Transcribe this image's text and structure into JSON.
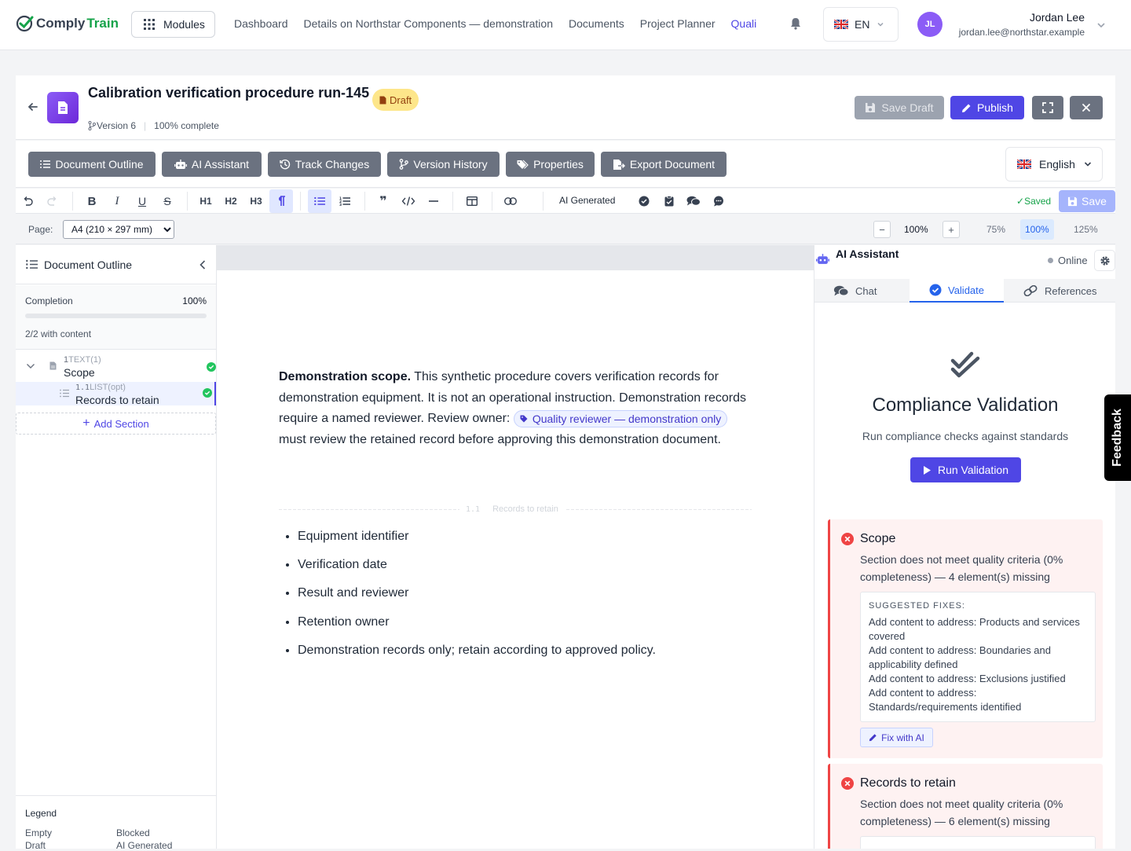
{
  "app": {
    "logo_part1": "Comply",
    "logo_part2": "Train",
    "modules_label": "Modules",
    "nav": [
      "Dashboard",
      "Details on Northstar Components — demonstration",
      "Documents",
      "Project Planner",
      "Quali"
    ],
    "lang_code": "EN"
  },
  "user": {
    "initials": "JL",
    "name": "Jordan Lee",
    "email": "jordan.lee@northstar.example"
  },
  "document": {
    "title": "Calibration verification procedure run-145",
    "status": "Draft",
    "version": "Version 6",
    "completion_text": "100% complete",
    "save_draft_label": "Save Draft",
    "publish_label": "Publish"
  },
  "views": [
    "Document Outline",
    "AI Assistant",
    "Track Changes",
    "Version History",
    "Properties",
    "Export Document"
  ],
  "language": "English",
  "format": {
    "h1": "H1",
    "h2": "H2",
    "h3": "H3",
    "ai_generated": "AI Generated",
    "saved": "Saved",
    "save": "Save"
  },
  "page": {
    "label": "Page:",
    "size": "A4 (210 × 297 mm)",
    "options": [
      "A4 (210 × 297 mm)"
    ],
    "zoom": "100%",
    "zoom_presets": [
      "75%",
      "100%",
      "125%"
    ],
    "zoom_minus": "−",
    "zoom_plus": "+"
  },
  "outline": {
    "title": "Document Outline",
    "completion_label": "Completion",
    "completion_value": "100%",
    "completion_fraction": 1.0,
    "content_count": "2/2 with content",
    "items": [
      {
        "num": "1",
        "type": "TEXT(1)",
        "name": "Scope"
      },
      {
        "num": "1.1",
        "type": "LIST(opt)",
        "name": "Records to retain"
      }
    ],
    "add_section": "Add Section",
    "legend_title": "Legend",
    "legend": [
      "Empty",
      "Blocked",
      "Draft",
      "AI Generated"
    ]
  },
  "editor": {
    "intro_bold": "Demonstration scope.",
    "intro_text": " This synthetic procedure covers verification records for demonstration equipment. It is not an operational instruction. Demonstration records require a named reviewer. Review owner: ",
    "chip": "Quality reviewer — demonstration only",
    "intro_tail": " must review the retained record before ap­proving this demonstration document.",
    "section_num": "1.1",
    "section_name": "Records to retain",
    "bullets": [
      "Equipment identifier",
      "Verification date",
      "Result and reviewer",
      "Retention owner",
      "Demonstration records only; retain according to approved policy."
    ]
  },
  "ai": {
    "title": "AI Assistant",
    "status": "Online",
    "tabs": [
      "Chat",
      "Validate",
      "References"
    ],
    "validation_title": "Compliance Validation",
    "validation_sub": "Run compliance checks against standards",
    "run_label": "Run Validation",
    "suggested_label": "SUGGESTED FIXES:",
    "fix_label": "Fix with AI",
    "results": [
      {
        "section": "Scope",
        "message": "Section does not meet quality criteria (0% completeness) — 4 element(s) missing",
        "fixes": [
          "Add content to address: Products and services covered",
          "Add content to address: Boundaries and applicability defined",
          "Add content to address: Exclusions justified",
          "Add content to address: Standards/requirements identified"
        ]
      },
      {
        "section": "Records to retain",
        "message": "Section does not meet quality criteria (0% completeness) — 6 element(s) missing",
        "fixes": []
      }
    ]
  },
  "feedback": "Feedback"
}
